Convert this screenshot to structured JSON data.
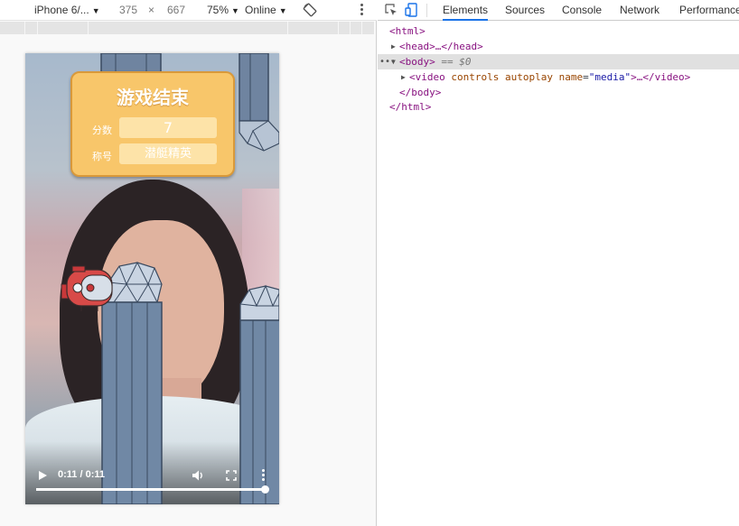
{
  "device_toolbar": {
    "device": "iPhone 6/...",
    "width": "375",
    "times": "×",
    "height": "667",
    "zoom": "75%",
    "network": "Online",
    "rotate_icon": "rotate-icon",
    "more_icon": "kebab-icon"
  },
  "game": {
    "title": "游戏结束",
    "score_label": "分数",
    "score_value": "7",
    "rank_label": "称号",
    "rank_value": "潜艇精英"
  },
  "video": {
    "time": "0:11 / 0:11",
    "progress": 1.0,
    "play_icon": "play-icon",
    "volume_icon": "volume-icon",
    "fullscreen_icon": "fullscreen-icon",
    "more_icon": "more-vert-icon"
  },
  "devtools": {
    "tabs": [
      "Elements",
      "Sources",
      "Console",
      "Network",
      "Performance"
    ],
    "active_tab": "Elements",
    "dom": {
      "html_open": "<html>",
      "head": "<head>…</head>",
      "body_open": "<body>",
      "body_marker": "== $0",
      "video_open": "<video",
      "video_attr1": "controls",
      "video_attr2": "autoplay",
      "video_attr3_name": "name",
      "video_attr3_value": "\"media\"",
      "video_close": ">…</video>",
      "body_close": "</body>",
      "html_close": "</html>"
    }
  },
  "colors": {
    "card": "#f8c66a",
    "card_border": "#d9993a",
    "tab_underline": "#1a73e8",
    "tag": "#881280",
    "attr": "#994500",
    "value": "#1a1aa6"
  }
}
